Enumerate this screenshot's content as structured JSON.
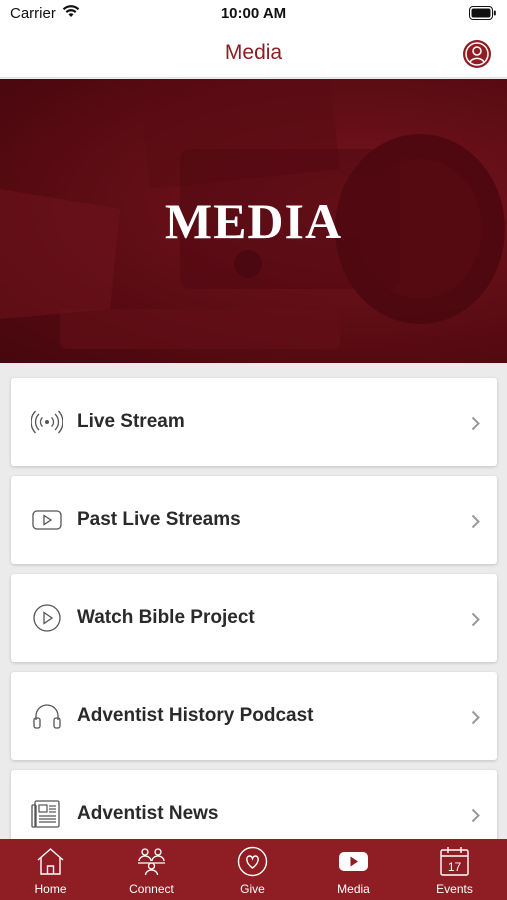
{
  "status_bar": {
    "carrier": "Carrier",
    "time": "10:00 AM"
  },
  "nav": {
    "title": "Media"
  },
  "hero": {
    "title": "MEDIA"
  },
  "menu": [
    {
      "label": "Live Stream",
      "icon": "broadcast-icon"
    },
    {
      "label": "Past Live Streams",
      "icon": "video-icon"
    },
    {
      "label": "Watch Bible Project",
      "icon": "play-circle-icon"
    },
    {
      "label": "Adventist History Podcast",
      "icon": "headphones-icon"
    },
    {
      "label": "Adventist News",
      "icon": "newspaper-icon"
    }
  ],
  "tabs": [
    {
      "label": "Home",
      "icon": "home-icon"
    },
    {
      "label": "Connect",
      "icon": "people-icon"
    },
    {
      "label": "Give",
      "icon": "heart-icon"
    },
    {
      "label": "Media",
      "icon": "youtube-icon",
      "active": true
    },
    {
      "label": "Events",
      "icon": "calendar-icon",
      "calendar_day": "17"
    }
  ],
  "colors": {
    "brand": "#8f1d24",
    "background": "#ebebeb",
    "card": "#ffffff"
  }
}
